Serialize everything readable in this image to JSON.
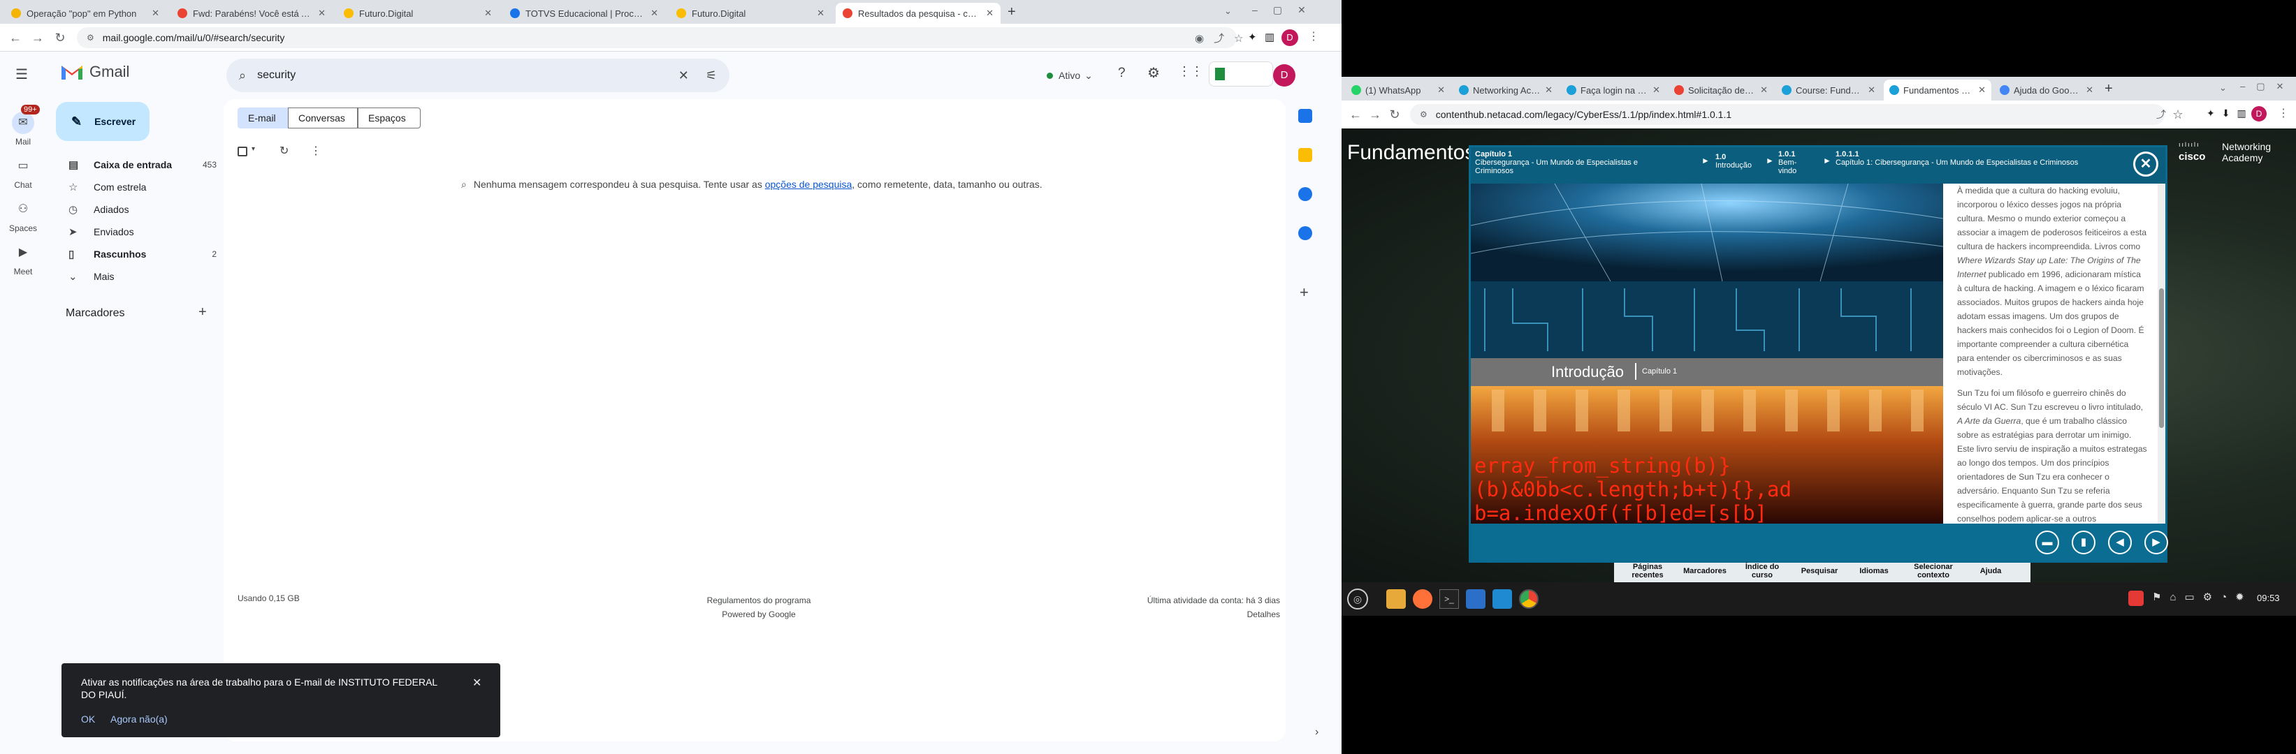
{
  "left_browser": {
    "tabs": [
      {
        "title": "Operação \"pop\" em Python",
        "color": "#f4b400"
      },
      {
        "title": "Fwd: Parabéns! Você está Al...",
        "color": "#ea4335"
      },
      {
        "title": "Futuro.Digital",
        "color": "#fbbc04"
      },
      {
        "title": "TOTVS Educacional | Proces...",
        "color": "#1a73e8"
      },
      {
        "title": "Futuro.Digital",
        "color": "#fbbc04"
      },
      {
        "title": "Resultados da pesquisa - cat...",
        "color": "#ea4335"
      }
    ],
    "new_tab": "+",
    "url": "mail.google.com/mail/u/0/#search/security",
    "profile_initial": "D"
  },
  "gmail": {
    "product": "Gmail",
    "search_value": "security",
    "status": "Ativo",
    "compose_label": "Escrever",
    "rail": [
      {
        "label": "Mail",
        "badge": "99+"
      },
      {
        "label": "Chat"
      },
      {
        "label": "Spaces"
      },
      {
        "label": "Meet"
      }
    ],
    "nav": [
      {
        "label": "Caixa de entrada",
        "count": "453",
        "icon": "inbox-icon"
      },
      {
        "label": "Com estrela",
        "count": "",
        "icon": "star-icon"
      },
      {
        "label": "Adiados",
        "count": "",
        "icon": "clock-icon"
      },
      {
        "label": "Enviados",
        "count": "",
        "icon": "send-icon"
      },
      {
        "label": "Rascunhos",
        "count": "2",
        "icon": "draft-icon"
      },
      {
        "label": "Mais",
        "count": "",
        "icon": "chevron-down-icon"
      }
    ],
    "labels_heading": "Marcadores",
    "chips": [
      "E-mail",
      "Conversas",
      "Espaços"
    ],
    "empty_prefix": "Nenhuma mensagem correspondeu à sua pesquisa. Tente usar as",
    "empty_link": "opções de pesquisa",
    "empty_suffix": ", como remetente, data, tamanho ou outras.",
    "footer_storage": "Usando 0,15 GB",
    "footer_policy": "Regulamentos do programa",
    "footer_powered": "Powered by Google",
    "footer_activity": "Última atividade da conta: há 3 dias",
    "footer_details": "Detalhes",
    "toast_text": "Ativar as notificações na área de trabalho para o E-mail de INSTITUTO FEDERAL DO PIAUÍ.",
    "toast_ok": "OK",
    "toast_later": "Agora não(a)"
  },
  "right_browser": {
    "tabs": [
      {
        "title": "(1) WhatsApp",
        "color": "#25d366"
      },
      {
        "title": "Networking Aca...",
        "color": "#1ba0d7"
      },
      {
        "title": "Faça login na C...",
        "color": "#1ba0d7"
      },
      {
        "title": "Solicitação de c...",
        "color": "#ea4335"
      },
      {
        "title": "Course: Fundam...",
        "color": "#1ba0d7"
      },
      {
        "title": "Fundamentos d...",
        "color": "#1ba0d7"
      },
      {
        "title": "Ajuda do Googl...",
        "color": "#4285f4"
      }
    ],
    "url": "contenthub.netacad.com/legacy/CyberEss/1.1/pp/index.html#1.0.1.1",
    "profile_initial": "D"
  },
  "netacad": {
    "page_title": "Fundamentos",
    "brand_line1": "Networking",
    "brand_line2": "Academy",
    "brand_cisco": "cisco",
    "crumb1_title": "Capítulo 1",
    "crumb1_sub": "Cibersegurança - Um Mundo de Especialistas e Criminosos",
    "crumb2_num": "1.0",
    "crumb2_sub": "Introdução",
    "crumb3_num": "1.0.1",
    "crumb3_sub": "Bem-vindo",
    "crumb4_num": "1.0.1.1",
    "crumb4_sub": "Capítulo 1: Cibersegurança - Um Mundo de Especialistas e Criminosos",
    "video_title": "Introdução",
    "video_chapter": "Capítulo 1",
    "code_text": "erray_from_string(b)}",
    "code_text2": "(b)&0bb<c.length;b+t){},ad",
    "code_text3": "b=a.indexOf(f[b]ed=[s[b]",
    "para1_a": "À medida que a cultura do hacking evoluiu, incorporou o léxico desses jogos na própria cultura. Mesmo o mundo exterior começou a associar a imagem de poderosos feiticeiros a esta cultura de hackers incompreendida. Livros como ",
    "para1_italic": "Where Wizards Stay up Late: The Origins of The Internet",
    "para1_b": " publicado em 1996, adicionaram mística à cultura de hacking. A imagem e o léxico ficaram associados. Muitos grupos de hackers ainda hoje adotam essas imagens. Um dos grupos de hackers mais conhecidos foi o Legion of Doom. É importante compreender a cultura cibernética para entender os cibercriminosos e as suas motivações.",
    "para2_a": "Sun Tzu foi um filósofo e guerreiro chinês do século VI AC. Sun Tzu escreveu o livro intitulado, ",
    "para2_italic": "A Arte da Guerra",
    "para2_b": ", que é um trabalho clássico sobre as estratégias para derrotar um inimigo. Este livro serviu de inspiração a muitos estrategas ao longo dos tempos. Um dos princípios orientadores de Sun Tzu era conhecer o adversário. Enquanto Sun Tzu se referia especificamente à guerra, grande parte dos seus conselhos podem aplicar-se a outros",
    "menu": [
      "Páginas recentes",
      "Marcadores",
      "Índice do curso",
      "Pesquisar",
      "Idiomas",
      "Selecionar contexto",
      "Ajuda"
    ]
  },
  "taskbar": {
    "time": "09:53"
  }
}
